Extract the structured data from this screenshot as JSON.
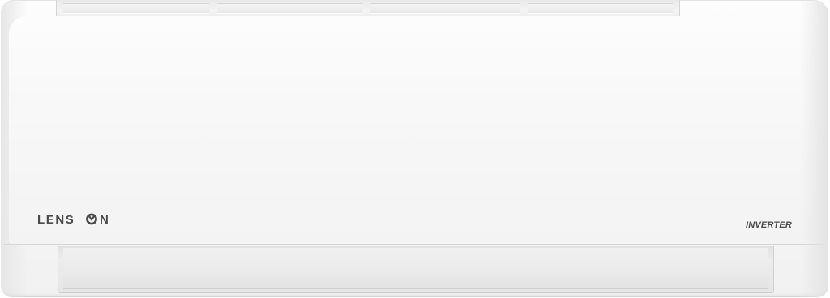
{
  "product": {
    "brand": "LENSON",
    "model_badge": "INVERTER"
  },
  "colors": {
    "body": "#f6f6f6",
    "logo": "#4a4a4a",
    "trim": "#d3d3d3"
  },
  "icons": {
    "logo": "lenson-logo-icon"
  }
}
